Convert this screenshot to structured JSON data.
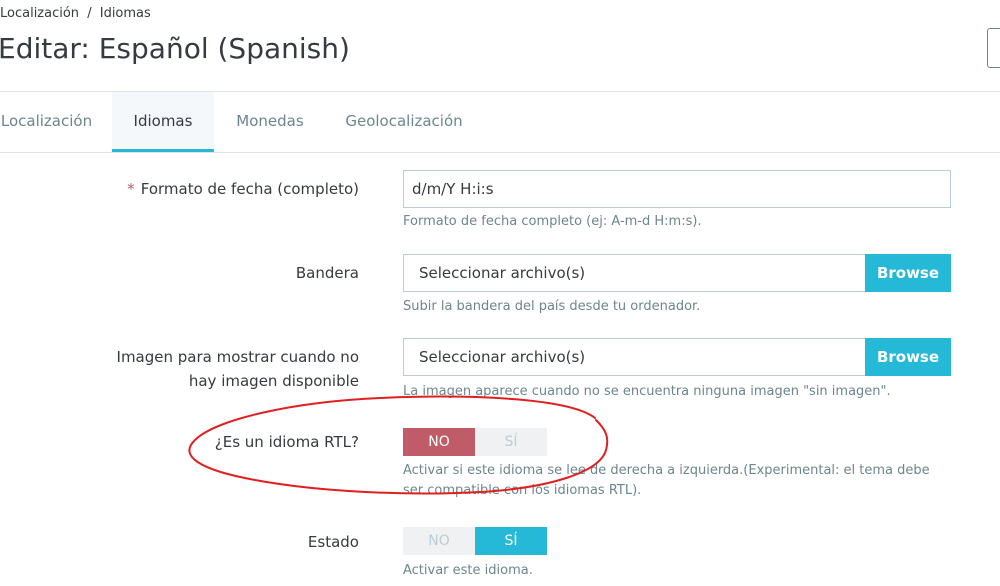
{
  "breadcrumb": {
    "item1": "Localización",
    "separator": "/",
    "item2": "Idiomas"
  },
  "title": "Editar: Español (Spanish)",
  "tabs": [
    {
      "label": "Localización",
      "active": false
    },
    {
      "label": "Idiomas",
      "active": true
    },
    {
      "label": "Monedas",
      "active": false
    },
    {
      "label": "Geolocalización",
      "active": false
    }
  ],
  "form": {
    "date_format": {
      "required_mark": "*",
      "label": "Formato de fecha (completo)",
      "value": "d/m/Y H:i:s",
      "help": "Formato de fecha completo (ej: A-m-d H:m:s)."
    },
    "flag": {
      "label": "Bandera",
      "file_placeholder": "Seleccionar archivo(s)",
      "browse_label": "Browse",
      "help": "Subir la bandera del país desde tu ordenador."
    },
    "no_image": {
      "label_line1": "Imagen para mostrar cuando no",
      "label_line2": "hay imagen disponible",
      "file_placeholder": "Seleccionar archivo(s)",
      "browse_label": "Browse",
      "help": "La imagen aparece cuando no se encuentra ninguna imagen \"sin imagen\"."
    },
    "rtl": {
      "label": "¿Es un idioma RTL?",
      "no_label": "NO",
      "yes_label": "SÍ",
      "selected": "NO",
      "help": "Activar si este idioma se lee de derecha a izquierda.(Experimental: el tema debe ser compatible con los idiomas RTL)."
    },
    "status": {
      "label": "Estado",
      "no_label": "NO",
      "yes_label": "SÍ",
      "selected": "SÍ",
      "help": "Activar este idioma."
    }
  },
  "colors": {
    "accent": "#25b9d7",
    "danger": "#c05c67",
    "annotation": "#e02020"
  }
}
